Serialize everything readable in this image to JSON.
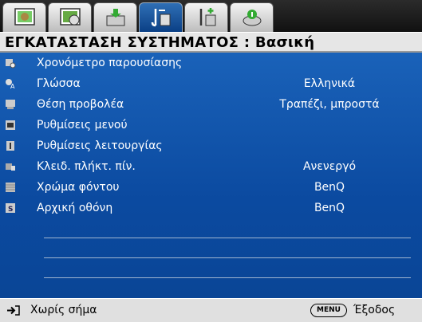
{
  "tabs": [
    {
      "icon": "picture-tab-icon",
      "active": false
    },
    {
      "icon": "picture-advanced-tab-icon",
      "active": false
    },
    {
      "icon": "display-tab-icon",
      "active": false
    },
    {
      "icon": "system-setup-basic-tab-icon",
      "active": true
    },
    {
      "icon": "system-setup-advanced-tab-icon",
      "active": false
    },
    {
      "icon": "information-tab-icon",
      "active": false
    }
  ],
  "header": {
    "title": "ΕΓΚΑΤΑΣΤΑΣΗ ΣΥΣΤΗΜΑΤΟΣ : Βασική"
  },
  "menu": {
    "items": [
      {
        "icon": "timer-icon",
        "label": "Χρονόμετρο παρουσίασης",
        "value": ""
      },
      {
        "icon": "language-icon",
        "label": "Γλώσσα",
        "value": "Ελληνικά"
      },
      {
        "icon": "projector-position-icon",
        "label": "Θέση προβολέα",
        "value": "Τραπέζι, μπροστά"
      },
      {
        "icon": "menu-settings-icon",
        "label": "Ρυθμίσεις μενού",
        "value": ""
      },
      {
        "icon": "operation-settings-icon",
        "label": "Ρυθμίσεις λειτουργίας",
        "value": ""
      },
      {
        "icon": "panel-key-lock-icon",
        "label": "Κλειδ. πλήκτ. πίν.",
        "value": "Ανενεργό"
      },
      {
        "icon": "background-color-icon",
        "label": "Χρώμα φόντου",
        "value": "BenQ"
      },
      {
        "icon": "splash-screen-icon",
        "label": "Αρχική οθόνη",
        "value": "BenQ"
      }
    ]
  },
  "footer": {
    "source_label": "Χωρίς σήμα",
    "menu_button": "MENU",
    "exit_label": "Έξοδος"
  },
  "colors": {
    "menu_bg": "#0b4aa0",
    "active_tab": "#1f5fae",
    "header_bg": "#e6e6e6"
  }
}
